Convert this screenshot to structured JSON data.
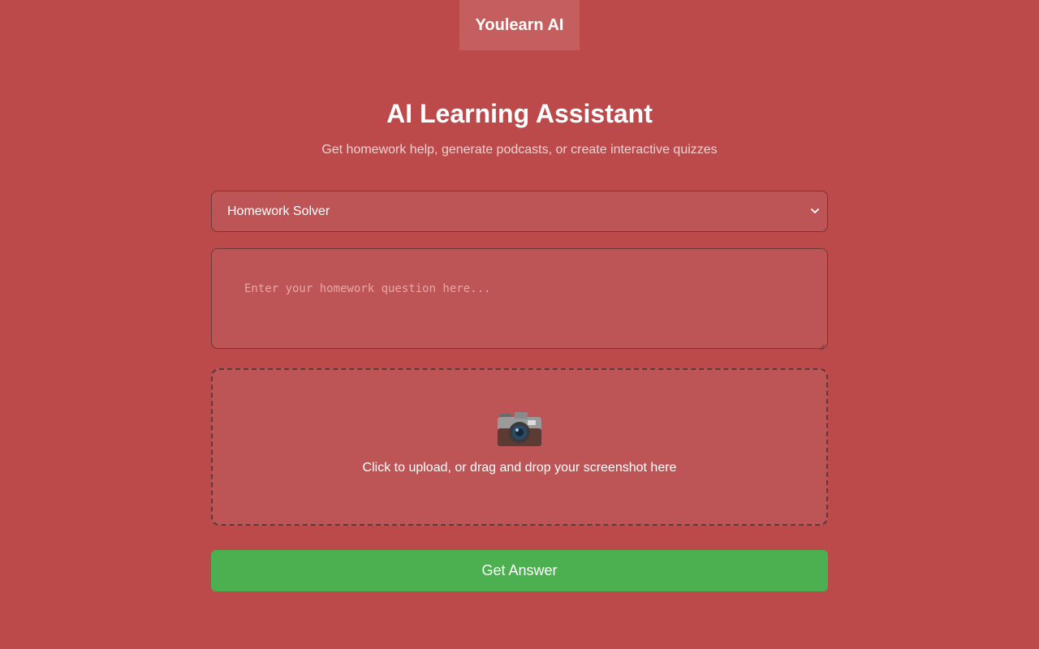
{
  "header": {
    "brand": "Youlearn AI"
  },
  "hero": {
    "title": "AI Learning Assistant",
    "subtitle": "Get homework help, generate podcasts, or create interactive quizzes"
  },
  "form": {
    "mode_select": {
      "selected": "Homework Solver"
    },
    "question": {
      "value": "",
      "placeholder": "Enter your homework question here..."
    },
    "upload": {
      "icon": "camera-icon",
      "text": "Click to upload, or drag and drop your screenshot here"
    },
    "submit_label": "Get Answer"
  },
  "colors": {
    "background": "#bc4a4b",
    "panel": "#bd5556",
    "brand_tab": "#c55f5f",
    "submit": "#4caf50"
  }
}
